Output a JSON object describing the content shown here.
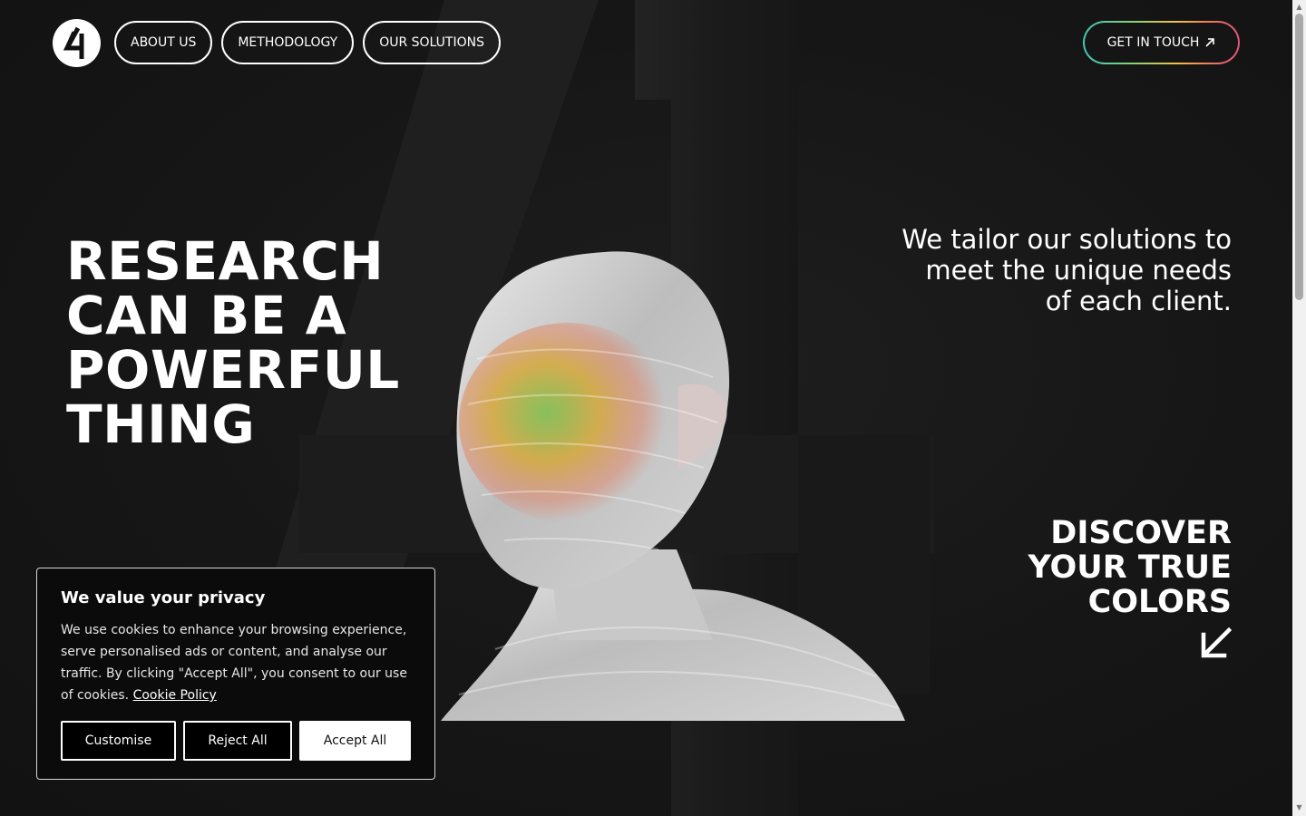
{
  "header": {
    "logo_text": "4",
    "nav": [
      {
        "label": "ABOUT US"
      },
      {
        "label": "METHODOLOGY"
      },
      {
        "label": "OUR SOLUTIONS"
      }
    ],
    "cta_label": "GET IN TOUCH",
    "cta_icon": "arrow-up-right-icon"
  },
  "hero": {
    "headline_lines": [
      "RESEARCH",
      "CAN BE A",
      "POWERFUL",
      "THING"
    ],
    "tagline_lines": [
      "We tailor our solutions to",
      "meet the unique needs",
      "of each client."
    ],
    "discover_lines": [
      "DISCOVER",
      "YOUR TRUE",
      "COLORS"
    ],
    "discover_icon": "arrow-down-left-icon"
  },
  "cookie_banner": {
    "title": "We value your privacy",
    "text": "We use cookies to enhance your browsing experience, serve personalised ads or content, and analyse our traffic. By clicking \"Accept All\", you consent to our use of cookies.",
    "link_label": "Cookie Policy",
    "buttons": {
      "customise": "Customise",
      "reject": "Reject All",
      "accept": "Accept All"
    }
  },
  "colors": {
    "background": "#141414",
    "text": "#ffffff",
    "cta_gradient": [
      "#3fc6b7",
      "#f1c04a",
      "#e0507f"
    ]
  }
}
